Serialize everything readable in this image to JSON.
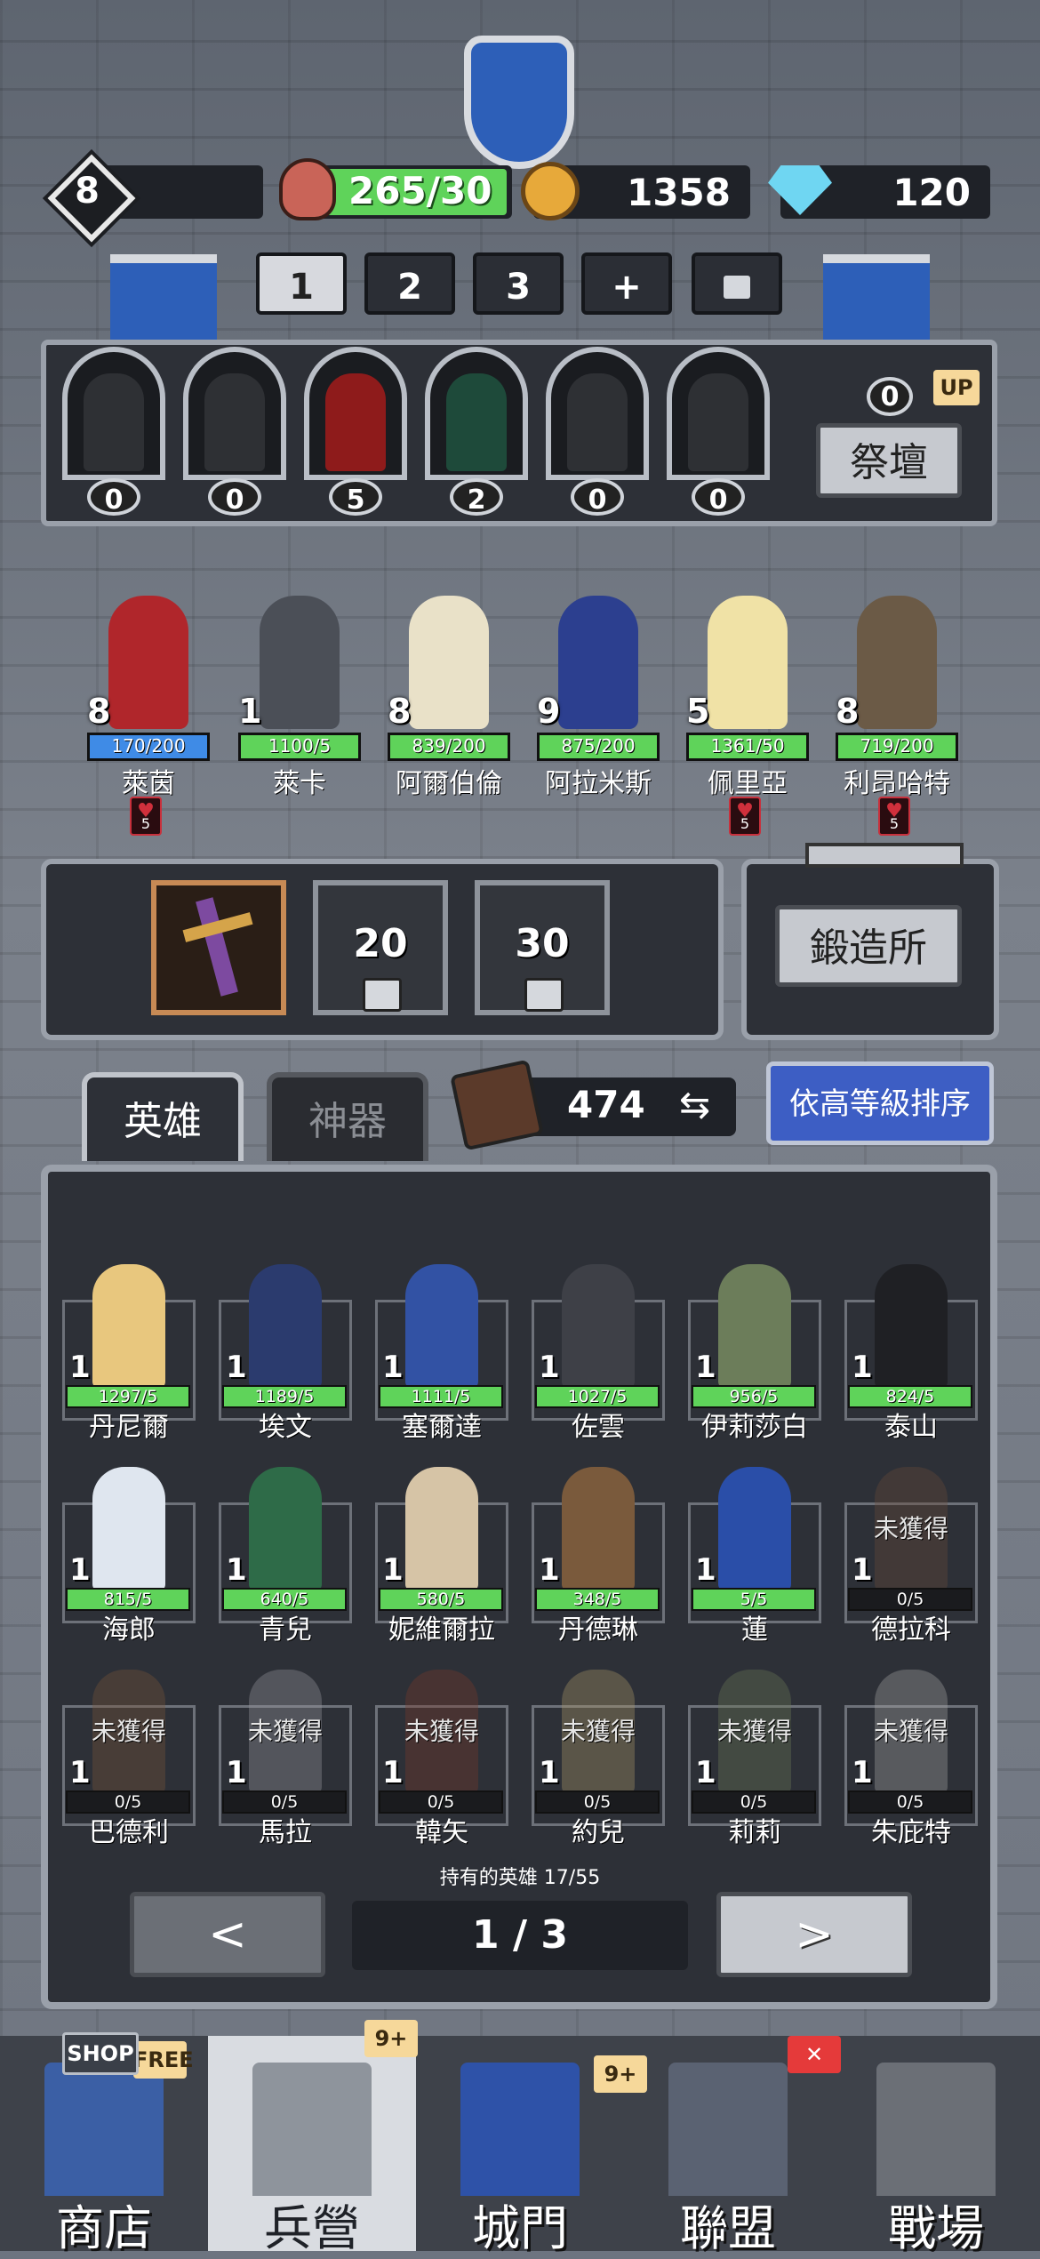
{
  "top": {
    "level": "8",
    "food": "265/30",
    "gold": "1358",
    "gems": "120"
  },
  "team_tabs": [
    "1",
    "2",
    "3",
    "+"
  ],
  "altar": {
    "statues": [
      {
        "count": "0",
        "color": "#2e3034"
      },
      {
        "count": "0",
        "color": "#2e3034"
      },
      {
        "count": "5",
        "color": "#8e1b1b"
      },
      {
        "count": "2",
        "color": "#1e4a3a"
      },
      {
        "count": "0",
        "color": "#2e3034"
      },
      {
        "count": "0",
        "color": "#2e3034"
      }
    ],
    "upgrade_count": "0",
    "up_badge": "UP",
    "button": "祭壇"
  },
  "team": [
    {
      "level": "8",
      "bar": "170/200",
      "name": "萊茵",
      "bar_color": "blue",
      "color": "#b0262b"
    },
    {
      "level": "1",
      "bar": "1100/5",
      "name": "萊卡",
      "bar_color": "green",
      "color": "#4b4f57"
    },
    {
      "level": "8",
      "bar": "839/200",
      "name": "阿爾伯倫",
      "bar_color": "green",
      "color": "#e9e1c8"
    },
    {
      "level": "9",
      "bar": "875/200",
      "name": "阿拉米斯",
      "bar_color": "green",
      "color": "#2c3f8f"
    },
    {
      "level": "5",
      "bar": "1361/50",
      "name": "佩里亞",
      "bar_color": "green",
      "color": "#f0e2a6"
    },
    {
      "level": "8",
      "bar": "719/200",
      "name": "利昂哈特",
      "bar_color": "green",
      "color": "#6b5a46"
    }
  ],
  "hearts": [
    "5",
    "5",
    "5"
  ],
  "weapons": {
    "locked_slots": [
      "20",
      "30"
    ],
    "forge_button": "鍛造所"
  },
  "list_tabs": {
    "heroes": "英雄",
    "artifacts": "神器"
  },
  "tomes": "474",
  "sort_button": "依高等級排序",
  "heroes": [
    {
      "level": "1",
      "bar": "1297/5",
      "name": "丹尼爾",
      "color": "#e8c77e"
    },
    {
      "level": "1",
      "bar": "1189/5",
      "name": "埃文",
      "color": "#2b3b6e"
    },
    {
      "level": "1",
      "bar": "1111/5",
      "name": "塞爾達",
      "color": "#3252a4"
    },
    {
      "level": "1",
      "bar": "1027/5",
      "name": "佐雲",
      "color": "#3e4047"
    },
    {
      "level": "1",
      "bar": "956/5",
      "name": "伊莉莎白",
      "color": "#6c7d5a"
    },
    {
      "level": "1",
      "bar": "824/5",
      "name": "泰山",
      "color": "#1f2024"
    },
    {
      "level": "1",
      "bar": "815/5",
      "name": "海郎",
      "color": "#dfe6ef"
    },
    {
      "level": "1",
      "bar": "640/5",
      "name": "青兒",
      "color": "#2e6b48"
    },
    {
      "level": "1",
      "bar": "580/5",
      "name": "妮維爾拉",
      "color": "#d6c4a6"
    },
    {
      "level": "1",
      "bar": "348/5",
      "name": "丹德琳",
      "color": "#7a5a3c"
    },
    {
      "level": "1",
      "bar": "5/5",
      "name": "蓮",
      "color": "#2a4ea8"
    },
    {
      "level": "1",
      "bar": "0/5",
      "name": "德拉科",
      "color": "#6b4a3a",
      "locked": "未獲得"
    },
    {
      "level": "1",
      "bar": "0/5",
      "name": "巴德利",
      "color": "#7a5638",
      "locked": "未獲得"
    },
    {
      "level": "1",
      "bar": "0/5",
      "name": "馬拉",
      "color": "#9a9aa2",
      "locked": "未獲得"
    },
    {
      "level": "1",
      "bar": "0/5",
      "name": "韓矢",
      "color": "#7a3a2c",
      "locked": "未獲得"
    },
    {
      "level": "1",
      "bar": "0/5",
      "name": "約兒",
      "color": "#b09a6a",
      "locked": "未獲得"
    },
    {
      "level": "1",
      "bar": "0/5",
      "name": "莉莉",
      "color": "#6e7c58",
      "locked": "未獲得"
    },
    {
      "level": "1",
      "bar": "0/5",
      "name": "朱庇特",
      "color": "#a9a9a9",
      "locked": "未獲得"
    }
  ],
  "owned": "持有的英雄 17/55",
  "pagination": {
    "prev": "<",
    "page": "1 / 3",
    "next": ">"
  },
  "nav": [
    {
      "label": "商店",
      "badge": "FREE",
      "sign": "SHOP",
      "color": "#3b5fa5"
    },
    {
      "label": "兵營",
      "badge": "9+",
      "color": "#8e949c"
    },
    {
      "label": "城門",
      "badge": "9+",
      "color": "#2e52a8"
    },
    {
      "label": "聯盟",
      "badge": "✕",
      "color": "#5a6272"
    },
    {
      "label": "戰場",
      "badge": "",
      "color": "#6b6f76"
    }
  ]
}
